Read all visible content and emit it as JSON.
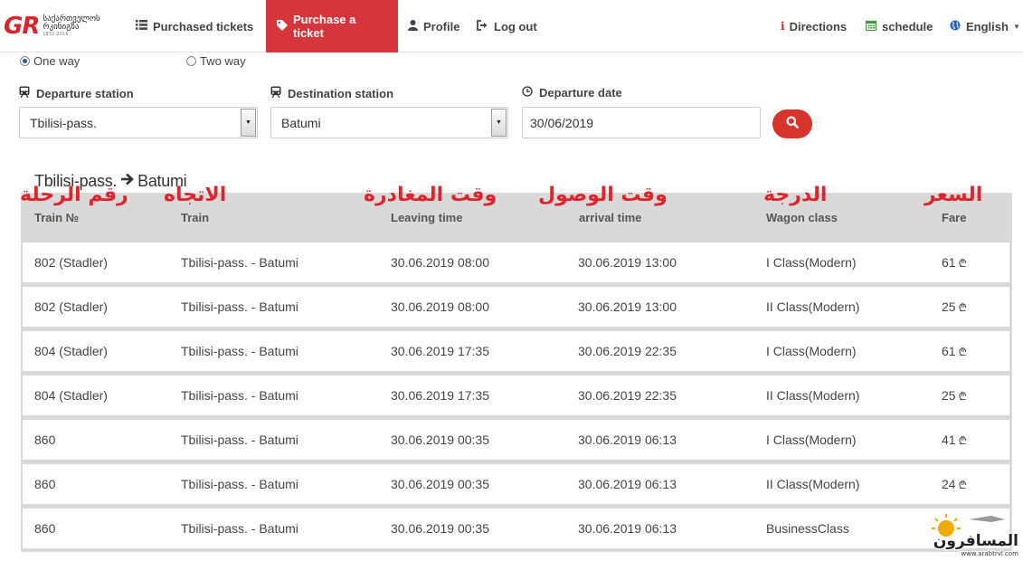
{
  "brand": {
    "logo_mark": "GR",
    "logo_line1": "საქართველოს",
    "logo_line2": "რკინიგზა",
    "logo_line3": "1872-2016"
  },
  "nav": {
    "purchased": {
      "label": "Purchased tickets",
      "icon": "list-icon"
    },
    "purchase": {
      "label": "Purchase a ticket",
      "icon": "tag-icon"
    },
    "profile": {
      "label": "Profile",
      "icon": "user-icon"
    },
    "logout": {
      "label": "Log out",
      "icon": "sign-out-icon"
    },
    "directions": {
      "label": "Directions",
      "icon": "info-icon"
    },
    "schedule": {
      "label": "schedule",
      "icon": "calendar-icon"
    },
    "language": {
      "label": "English",
      "icon": "globe-icon"
    }
  },
  "trip_type": {
    "one_way": "One way",
    "two_way": "Two way",
    "selected": "One way"
  },
  "form": {
    "departure_label": "Departure station",
    "departure_value": "Tbilisi-pass.",
    "destination_label": "Destination station",
    "destination_value": "Batumi",
    "date_label": "Departure date",
    "date_value": "30/06/2019"
  },
  "route": {
    "from": "Tbilisi-pass.",
    "to": "Batumi"
  },
  "table": {
    "headers": [
      "Train №",
      "Train",
      "Leaving time",
      "arrival time",
      "Wagon class",
      "Fare"
    ],
    "currency_symbol": "₾",
    "rows": [
      {
        "train_no": "802 (Stadler)",
        "train": "Tbilisi-pass. - Batumi",
        "leaving": "30.06.2019 08:00",
        "arrival": "30.06.2019 13:00",
        "wagon": "I Class(Modern)",
        "fare": "61"
      },
      {
        "train_no": "802 (Stadler)",
        "train": "Tbilisi-pass. - Batumi",
        "leaving": "30.06.2019 08:00",
        "arrival": "30.06.2019 13:00",
        "wagon": "II Class(Modern)",
        "fare": "25"
      },
      {
        "train_no": "804 (Stadler)",
        "train": "Tbilisi-pass. - Batumi",
        "leaving": "30.06.2019 17:35",
        "arrival": "30.06.2019 22:35",
        "wagon": "I Class(Modern)",
        "fare": "61"
      },
      {
        "train_no": "804 (Stadler)",
        "train": "Tbilisi-pass. - Batumi",
        "leaving": "30.06.2019 17:35",
        "arrival": "30.06.2019 22:35",
        "wagon": "II Class(Modern)",
        "fare": "25"
      },
      {
        "train_no": "860",
        "train": "Tbilisi-pass. - Batumi",
        "leaving": "30.06.2019 00:35",
        "arrival": "30.06.2019 06:13",
        "wagon": "I Class(Modern)",
        "fare": "41"
      },
      {
        "train_no": "860",
        "train": "Tbilisi-pass. - Batumi",
        "leaving": "30.06.2019 00:35",
        "arrival": "30.06.2019 06:13",
        "wagon": "II Class(Modern)",
        "fare": "24"
      },
      {
        "train_no": "860",
        "train": "Tbilisi-pass. - Batumi",
        "leaving": "30.06.2019 00:35",
        "arrival": "30.06.2019 06:13",
        "wagon": "BusinessClass",
        "fare": ""
      }
    ]
  },
  "annotations": [
    "رقم الرحلة",
    "الاتجاه",
    "وقت المغادرة",
    "وقت الوصول",
    "الدرجة",
    "السعر"
  ],
  "watermark": {
    "line1": "المسافرون",
    "line2": "www.arabtrvl.com"
  },
  "colors": {
    "accent": "#d6353b",
    "search_button": "#d7342c",
    "annotation": "#e0242b",
    "table_bg": "#d9d9d9"
  }
}
